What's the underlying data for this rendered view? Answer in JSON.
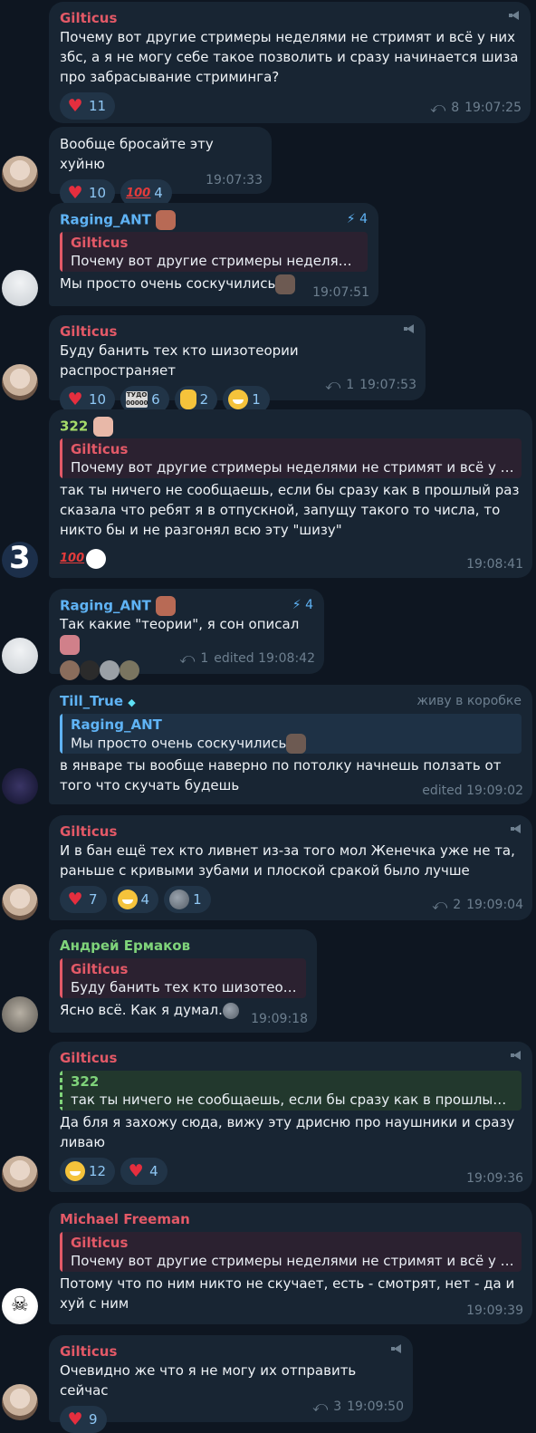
{
  "messages": [
    {
      "author": "Gilticus",
      "text": "Почему вот другие стримеры неделями не стримят и всё у них збс, а я не могу себе такое позволить и сразу начинается шиза про забрасывание стриминга?",
      "reactions": [
        {
          "icon": "heart",
          "count": "11"
        }
      ],
      "replies": "8",
      "time": "19:07:25"
    },
    {
      "text": "Вообще бросайте эту хуйню",
      "reactions": [
        {
          "icon": "heart",
          "count": "10"
        },
        {
          "icon": "hundred",
          "count": "4"
        }
      ],
      "time": "19:07:33"
    },
    {
      "author": "Raging_ANT",
      "boost": "4",
      "reply_name": "Gilticus",
      "reply_text": "Почему вот другие стримеры неделям...",
      "text": "Мы просто очень соскучились",
      "time": "19:07:51"
    },
    {
      "author": "Gilticus",
      "text": "Буду банить тех кто шизотеории распространяет",
      "reactions": [
        {
          "icon": "heart",
          "count": "10"
        },
        {
          "icon": "ticket",
          "count": "6"
        },
        {
          "icon": "thumb",
          "count": "2"
        },
        {
          "icon": "grin",
          "count": "1"
        }
      ],
      "replies": "1",
      "time": "19:07:53"
    },
    {
      "author": "322",
      "reply_name": "Gilticus",
      "reply_text": "Почему вот другие стримеры неделями не стримят и всё у н...",
      "text": "так ты ничего не сообщаешь, если бы сразу как в прошлый раз сказала что ребят я в отпускной, запущу такого то числа, то никто бы и не разгонял всю эту \"шизу\"",
      "time": "19:08:41"
    },
    {
      "author": "Raging_ANT",
      "boost": "4",
      "text": "Так какие \"теории\", я сон описал",
      "replies": "1",
      "time": "edited 19:08:42"
    },
    {
      "author": "Till_True",
      "tag": "живу в коробке",
      "reply_name": "Raging_ANT",
      "reply_text": "Мы просто очень соскучились",
      "text": "в январе ты вообще наверно по потолку начнешь ползать от того что скучать будешь",
      "time": "edited 19:09:02"
    },
    {
      "author": "Gilticus",
      "text": "И в бан ещё тех кто ливнет из-за того мол Женечка уже не та, раньше с кривыми зубами и плоской сракой было лучше",
      "reactions": [
        {
          "icon": "heart",
          "count": "7"
        },
        {
          "icon": "grin",
          "count": "4"
        },
        {
          "icon": "moon",
          "count": "1"
        }
      ],
      "replies": "2",
      "time": "19:09:04"
    },
    {
      "author": "Андрей Ермаков",
      "reply_name": "Gilticus",
      "reply_text": "Буду банить тех кто шизотеор...",
      "text": "Ясно всё. Как я думал.",
      "time": "19:09:18"
    },
    {
      "author": "Gilticus",
      "reply_name": "322",
      "reply_text": "так ты ничего не сообщаешь, если бы сразу как в прошлый ...",
      "text": "Да бля я захожу сюда, вижу эту дрисню про наушники и сразу ливаю",
      "reactions": [
        {
          "icon": "grin",
          "count": "12"
        },
        {
          "icon": "heart",
          "count": "4"
        }
      ],
      "time": "19:09:36"
    },
    {
      "author": "Michael Freeman",
      "reply_name": "Gilticus",
      "reply_text": "Почему вот другие стримеры неделями не стримят и всё у н...",
      "text": "Потому что по ним никто не скучает, есть - смотрят, нет - да и хуй с ним",
      "time": "19:09:39"
    },
    {
      "author": "Gilticus",
      "text": "Очевидно же что я не могу их отправить сейчас",
      "reactions": [
        {
          "icon": "heart",
          "count": "9"
        }
      ],
      "replies": "3",
      "time": "19:09:50"
    }
  ],
  "icons": {
    "heart": "♥",
    "hundred": "100",
    "reply": "⤺",
    "boost": "⚡",
    "ticket": "ТУДО 00000"
  },
  "colors": {
    "background": "#0e1621",
    "bubble": "#182533",
    "name_red": "#e35967",
    "name_blue": "#5fb3f5",
    "name_green": "#7fd37a"
  }
}
